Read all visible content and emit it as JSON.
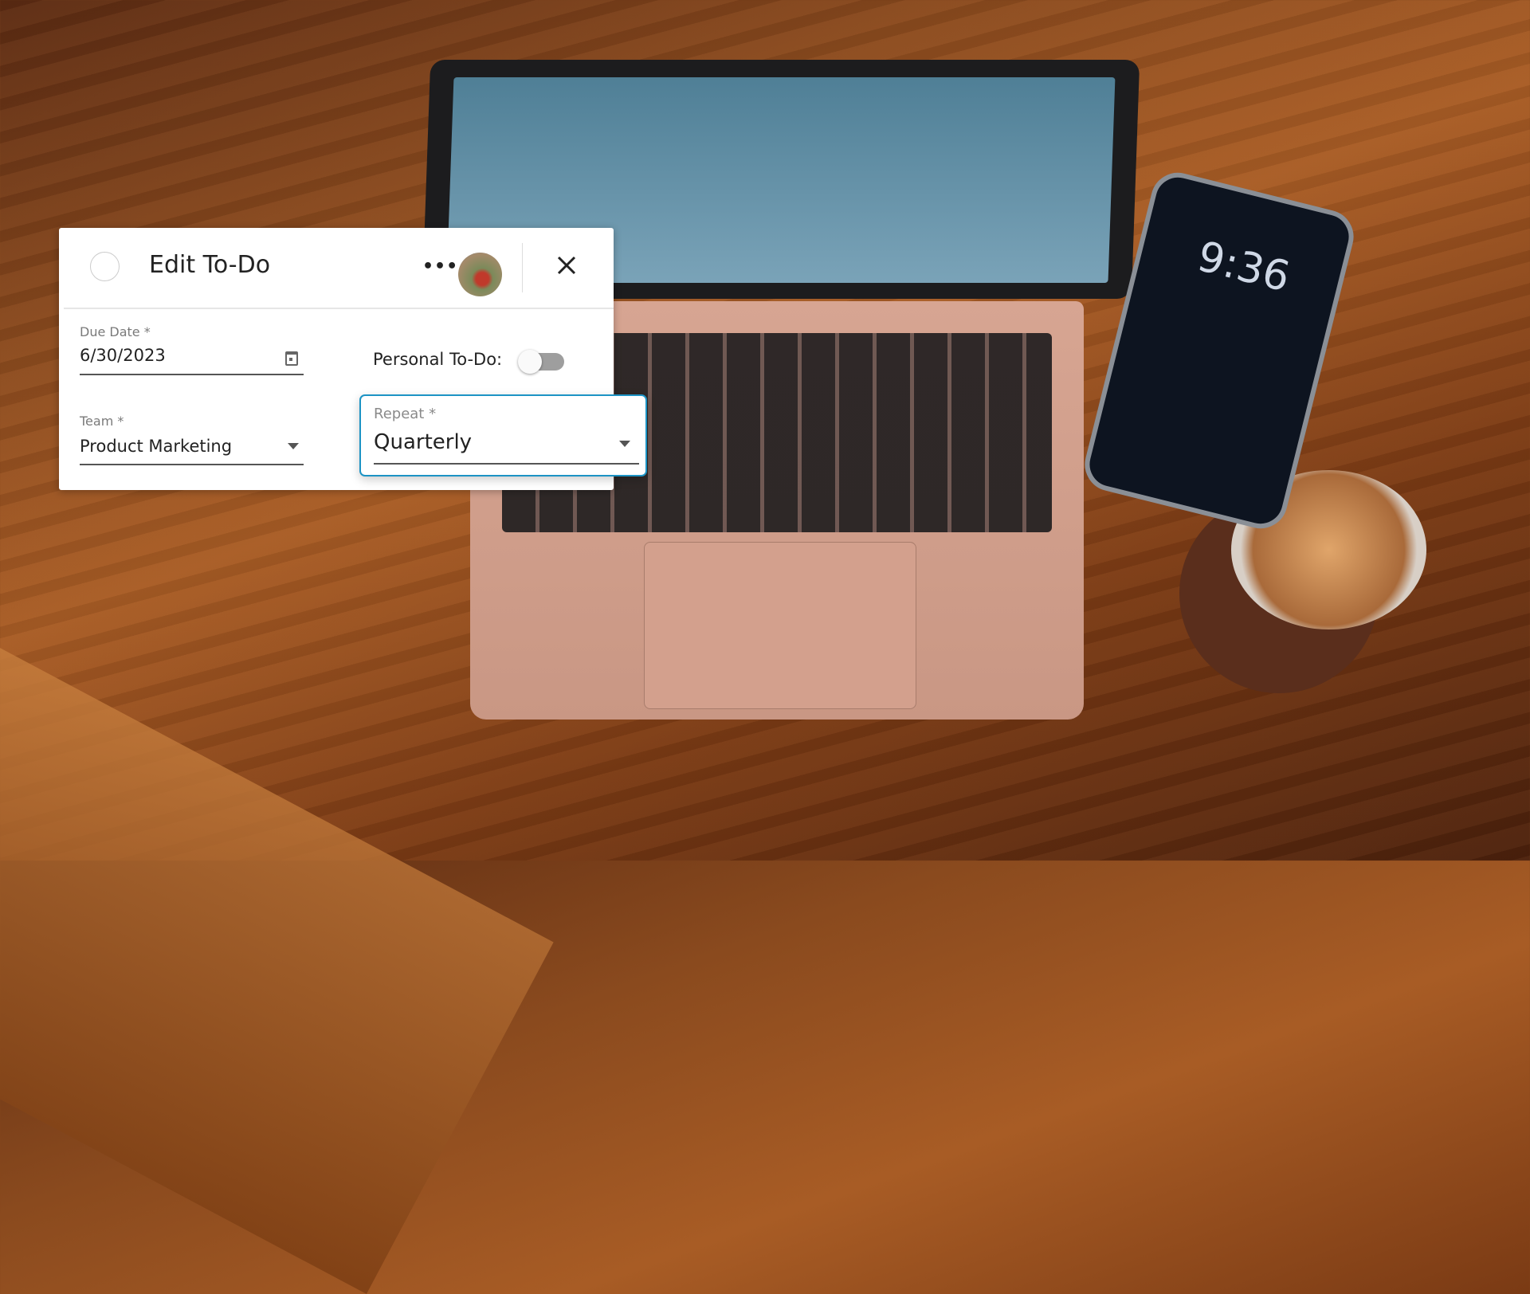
{
  "dialog": {
    "title": "Edit To-Do",
    "more_icon": "more-horizontal-icon",
    "close_icon": "close-icon",
    "complete_icon": "circle-checkbox-icon"
  },
  "fields": {
    "due_date": {
      "label": "Due Date *",
      "value": "6/30/2023",
      "icon": "calendar-icon"
    },
    "personal": {
      "label": "Personal To-Do:",
      "checked": false
    },
    "team": {
      "label": "Team *",
      "value": "Product Marketing"
    },
    "repeat": {
      "label": "Repeat *",
      "value": "Quarterly"
    }
  },
  "colors": {
    "focus_border": "#1c93c4"
  },
  "background": {
    "phone_time": "9:36"
  }
}
